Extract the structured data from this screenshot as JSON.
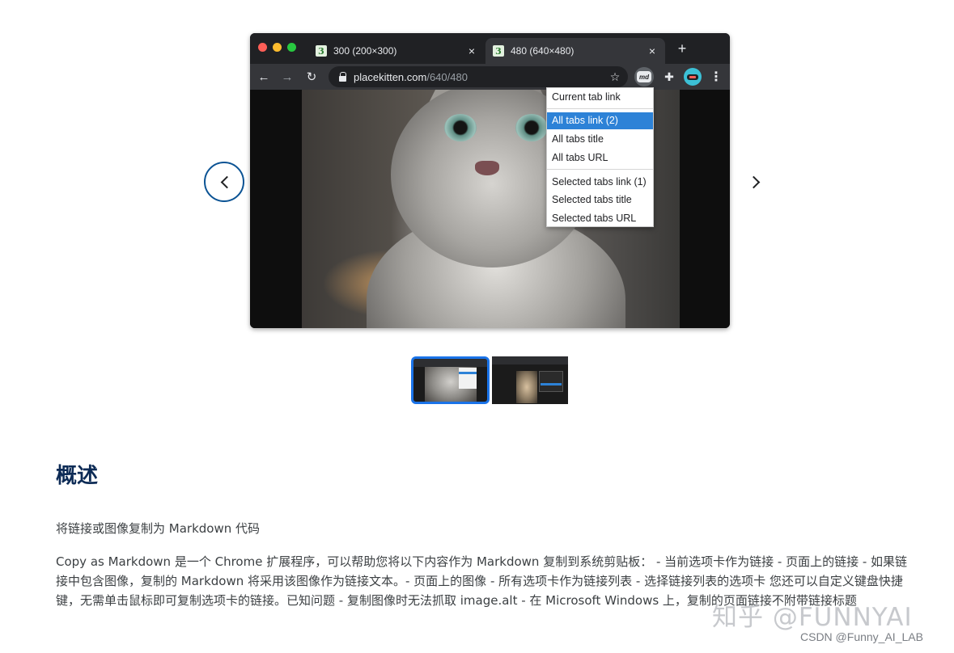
{
  "browser": {
    "tabs": [
      {
        "favicon": "3",
        "title": "300 (200×300)",
        "close": "×"
      },
      {
        "favicon": "3",
        "title": "480 (640×480)",
        "close": "×"
      }
    ],
    "new_tab": "+",
    "url_host": "placekitten.com",
    "url_path": "/640/480",
    "extension_label": "md",
    "context_menu": {
      "items": [
        "Current tab link",
        "All tabs link (2)",
        "All tabs title",
        "All tabs URL",
        "Selected tabs link (1)",
        "Selected tabs title",
        "Selected tabs URL"
      ],
      "active_index": 1
    }
  },
  "icons": {
    "back": "←",
    "forward": "→",
    "reload": "↻",
    "star": "☆",
    "puzzle": "✚",
    "kebab": "⋮"
  },
  "carousel": {
    "slide_count": 2,
    "active_slide": 1
  },
  "overview": {
    "title": "概述",
    "summary": "将链接或图像复制为 Markdown 代码",
    "description": "Copy as Markdown 是一个 Chrome 扩展程序，可以帮助您将以下内容作为 Markdown 复制到系统剪贴板： - 当前选项卡作为链接 - 页面上的链接 - 如果链接中包含图像，复制的 Markdown 将采用该图像作为链接文本。- 页面上的图像 - 所有选项卡作为链接列表 - 选择链接列表的选项卡 您还可以自定义键盘快捷键，无需单击鼠标即可复制选项卡的链接。已知问题 - 复制图像时无法抓取 image.alt - 在 Microsoft Windows 上，复制的页面链接不附带链接标题"
  },
  "watermark": "知乎 @FUNNYAI",
  "credit": "CSDN @Funny_AI_LAB",
  "colors": {
    "accent": "#1a73e8",
    "menu_highlight": "#2d82d7",
    "heading": "#0d2b56"
  }
}
